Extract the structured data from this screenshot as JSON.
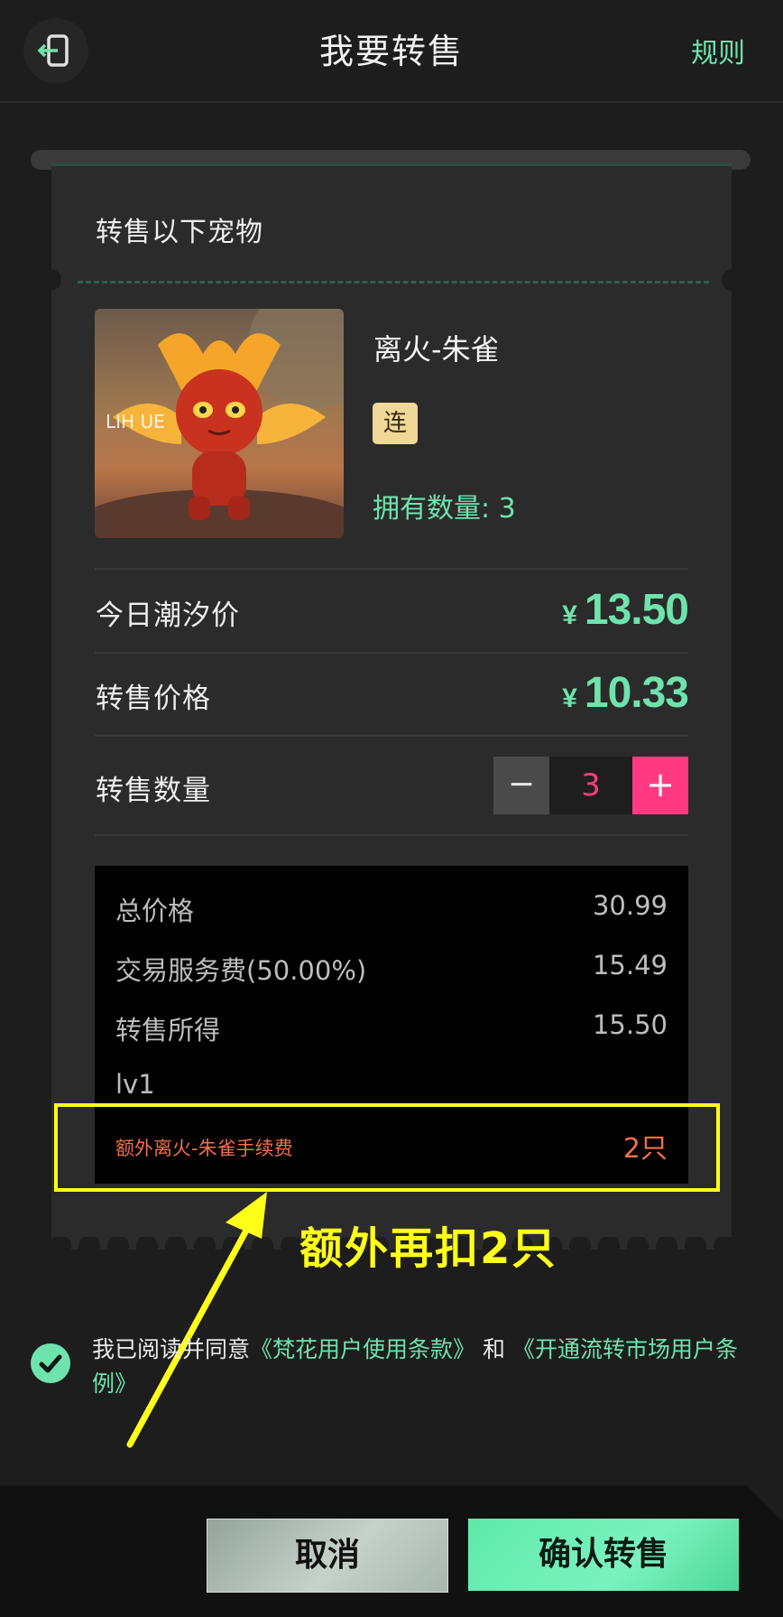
{
  "header": {
    "title": "我要转售",
    "rules_label": "规则",
    "back_icon": "exit-door-icon"
  },
  "ticket": {
    "section_title": "转售以下宠物",
    "pet": {
      "name": "离火-朱雀",
      "tag": "连",
      "owned": "拥有数量: 3",
      "image_text": "LIH                  UE"
    },
    "today_price": {
      "label": "今日潮汐价",
      "currency": "¥",
      "value": "13.50"
    },
    "resale_price": {
      "label": "转售价格",
      "currency": "¥",
      "value": "10.33"
    },
    "quantity": {
      "label": "转售数量",
      "minus": "−",
      "value": "3",
      "plus": "+"
    },
    "summary": {
      "total_label": "总价格",
      "total_value": "30.99",
      "fee_label": "交易服务费(50.00%)",
      "fee_value": "15.49",
      "income_label": "转售所得",
      "income_value": "15.50",
      "level_label": "lv1",
      "extra_fee_label": "额外离火-朱雀手续费",
      "extra_fee_value": "2只"
    }
  },
  "annotation": {
    "text": "额外再扣2只",
    "color": "#ffff1a"
  },
  "agreement": {
    "prefix": "我已阅读并同意",
    "link1": "《梵花用户使用条款》",
    "middle": "和",
    "link2": "《开通流转市场用户条例》"
  },
  "footer": {
    "cancel_label": "取消",
    "confirm_label": "确认转售"
  },
  "colors": {
    "accent_green": "#6fe3ad",
    "accent_pink": "#ff3a80",
    "fee_orange": "#f0714a",
    "background": "#1d1d1d"
  }
}
